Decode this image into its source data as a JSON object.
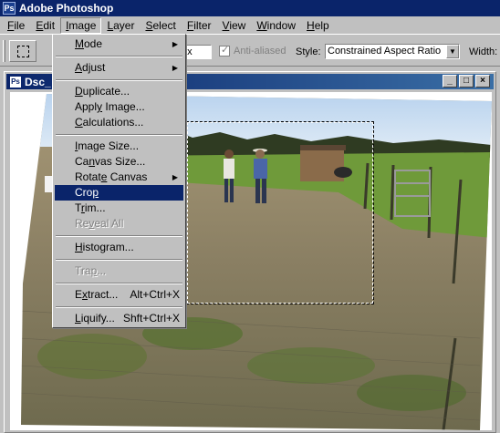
{
  "app": {
    "title": "Adobe Photoshop",
    "icon": "photoshop-icon"
  },
  "menubar": {
    "items": [
      {
        "label": "File",
        "u": "F",
        "rest": "ile"
      },
      {
        "label": "Edit",
        "u": "E",
        "rest": "dit"
      },
      {
        "label": "Image",
        "u": "I",
        "rest": "mage",
        "active": true
      },
      {
        "label": "Layer",
        "u": "L",
        "rest": "ayer"
      },
      {
        "label": "Select",
        "u": "S",
        "rest": "elect"
      },
      {
        "label": "Filter",
        "u": "F",
        "rest": "ilter"
      },
      {
        "label": "View",
        "u": "V",
        "rest": "iew"
      },
      {
        "label": "Window",
        "u": "W",
        "rest": "indow"
      },
      {
        "label": "Help",
        "u": "H",
        "rest": "elp"
      }
    ]
  },
  "options": {
    "feather_value": "px",
    "anti_aliased_label": "Anti-aliased",
    "anti_aliased_checked": true,
    "style_label": "Style:",
    "style_value": "Constrained Aspect Ratio",
    "width_label": "Width:"
  },
  "document": {
    "title": "Dsc_",
    "buttons": [
      "_",
      "□",
      "×"
    ]
  },
  "image_menu": [
    {
      "type": "item",
      "pre": "",
      "u": "M",
      "post": "ode",
      "submenu": true
    },
    {
      "type": "sep"
    },
    {
      "type": "item",
      "pre": "",
      "u": "A",
      "post": "djust",
      "submenu": true
    },
    {
      "type": "sep"
    },
    {
      "type": "item",
      "pre": "",
      "u": "D",
      "post": "uplicate..."
    },
    {
      "type": "item",
      "pre": "Appl",
      "u": "y",
      "post": " Image..."
    },
    {
      "type": "item",
      "pre": "",
      "u": "C",
      "post": "alculations..."
    },
    {
      "type": "sep"
    },
    {
      "type": "item",
      "pre": "",
      "u": "I",
      "post": "mage Size..."
    },
    {
      "type": "item",
      "pre": "Ca",
      "u": "n",
      "post": "vas Size..."
    },
    {
      "type": "item",
      "pre": "Rotat",
      "u": "e",
      "post": " Canvas",
      "submenu": true
    },
    {
      "type": "item",
      "pre": "Cro",
      "u": "p",
      "post": "",
      "selected": true
    },
    {
      "type": "item",
      "pre": "T",
      "u": "r",
      "post": "im..."
    },
    {
      "type": "item",
      "pre": "Re",
      "u": "v",
      "post": "eal All",
      "disabled": true
    },
    {
      "type": "sep"
    },
    {
      "type": "item",
      "pre": "",
      "u": "H",
      "post": "istogram..."
    },
    {
      "type": "sep"
    },
    {
      "type": "item",
      "pre": "Tra",
      "u": "p",
      "post": "...",
      "disabled": true
    },
    {
      "type": "sep"
    },
    {
      "type": "item",
      "pre": "E",
      "u": "x",
      "post": "tract...",
      "shortcut": "Alt+Ctrl+X"
    },
    {
      "type": "sep"
    },
    {
      "type": "item",
      "pre": "",
      "u": "L",
      "post": "iquify...",
      "shortcut": "Shft+Ctrl+X"
    }
  ]
}
